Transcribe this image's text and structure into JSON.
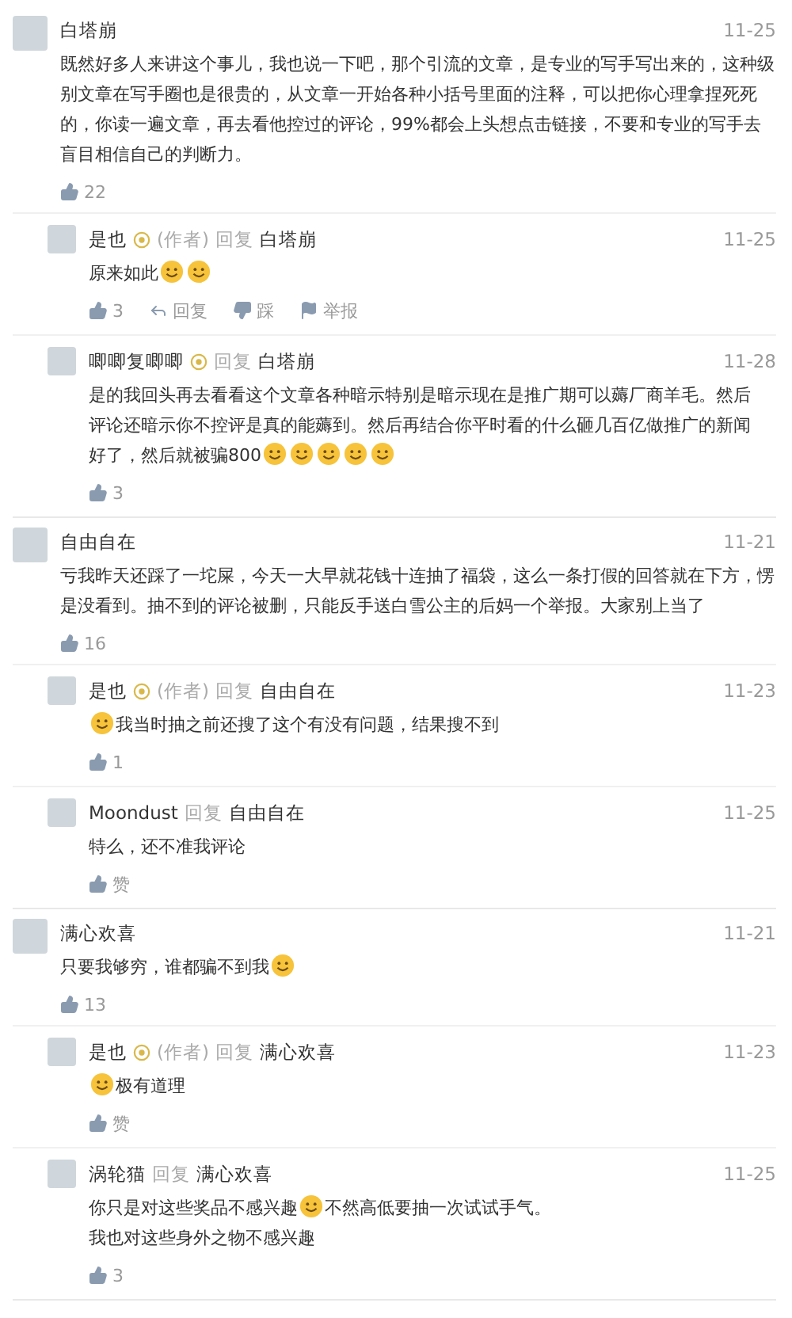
{
  "threads": [
    {
      "author": "白塔崩",
      "date": "11-25",
      "content": [
        {
          "kind": "text",
          "text": "既然好多人来讲这个事儿，我也说一下吧，那个引流的文章，是专业的写手写出来的，这种级别文章在写手圈也是很贵的，从文章一开始各种小括号里面的注释，可以把你心理拿捏死死的，你读一遍文章，再去看他控过的评论，99%都会上头想点击链接，不要和专业的写手去盲目相信自己的判断力。"
        }
      ],
      "actions": [
        {
          "kind": "like",
          "label": "22"
        }
      ],
      "replies": [
        {
          "author": "是也",
          "badge": true,
          "author_tag": "(作者)",
          "reply_label": "回复",
          "target": "白塔崩",
          "date": "11-25",
          "content": [
            {
              "kind": "text",
              "text": "原来如此"
            },
            {
              "kind": "emoji"
            },
            {
              "kind": "emoji"
            }
          ],
          "actions": [
            {
              "kind": "like",
              "label": "3"
            },
            {
              "kind": "reply",
              "label": "回复"
            },
            {
              "kind": "dislike",
              "label": "踩"
            },
            {
              "kind": "report",
              "label": "举报"
            }
          ]
        },
        {
          "author": "唧唧复唧唧",
          "badge": true,
          "reply_label": "回复",
          "target": "白塔崩",
          "date": "11-28",
          "content": [
            {
              "kind": "text",
              "text": "是的我回头再去看看这个文章各种暗示特别是暗示现在是推广期可以薅厂商羊毛。然后"
            },
            {
              "kind": "break"
            },
            {
              "kind": "text",
              "text": "评论还暗示你不控评是真的能薅到。然后再结合你平时看的什么砸几百亿做推广的新闻"
            },
            {
              "kind": "break"
            },
            {
              "kind": "text",
              "text": "好了，然后就被骗800"
            },
            {
              "kind": "emoji"
            },
            {
              "kind": "emoji"
            },
            {
              "kind": "emoji"
            },
            {
              "kind": "emoji"
            },
            {
              "kind": "emoji"
            }
          ],
          "actions": [
            {
              "kind": "like",
              "label": "3"
            }
          ]
        }
      ]
    },
    {
      "author": "自由自在",
      "date": "11-21",
      "content": [
        {
          "kind": "text",
          "text": "亏我昨天还踩了一坨屎，今天一大早就花钱十连抽了福袋，这么一条打假的回答就在下方，愣是没看到。抽不到的评论被删，只能反手送白雪公主的后妈一个举报。大家别上当了"
        }
      ],
      "actions": [
        {
          "kind": "like",
          "label": "16"
        }
      ],
      "replies": [
        {
          "author": "是也",
          "badge": true,
          "author_tag": "(作者)",
          "reply_label": "回复",
          "target": "自由自在",
          "date": "11-23",
          "content": [
            {
              "kind": "emoji"
            },
            {
              "kind": "text",
              "text": "我当时抽之前还搜了这个有没有问题，结果搜不到"
            }
          ],
          "actions": [
            {
              "kind": "like",
              "label": "1"
            }
          ]
        },
        {
          "author": "Moondust",
          "badge": false,
          "reply_label": "回复",
          "target": "自由自在",
          "date": "11-25",
          "content": [
            {
              "kind": "text",
              "text": "特么，还不准我评论"
            }
          ],
          "actions": [
            {
              "kind": "like",
              "label": "赞"
            }
          ]
        }
      ]
    },
    {
      "author": "满心欢喜",
      "date": "11-21",
      "content": [
        {
          "kind": "text",
          "text": "只要我够穷，谁都骗不到我"
        },
        {
          "kind": "emoji"
        }
      ],
      "actions": [
        {
          "kind": "like",
          "label": "13"
        }
      ],
      "replies": [
        {
          "author": "是也",
          "badge": true,
          "author_tag": "(作者)",
          "reply_label": "回复",
          "target": "满心欢喜",
          "date": "11-23",
          "content": [
            {
              "kind": "emoji"
            },
            {
              "kind": "text",
              "text": "极有道理"
            }
          ],
          "actions": [
            {
              "kind": "like",
              "label": "赞"
            }
          ]
        },
        {
          "author": "涡轮猫",
          "badge": false,
          "reply_label": "回复",
          "target": "满心欢喜",
          "date": "11-25",
          "content": [
            {
              "kind": "text",
              "text": "你只是对这些奖品不感兴趣"
            },
            {
              "kind": "emoji"
            },
            {
              "kind": "text",
              "text": "不然高低要抽一次试试手气。"
            },
            {
              "kind": "break"
            },
            {
              "kind": "text",
              "text": "我也对这些身外之物不感兴趣"
            }
          ],
          "actions": [
            {
              "kind": "like",
              "label": "3"
            }
          ]
        }
      ]
    }
  ]
}
